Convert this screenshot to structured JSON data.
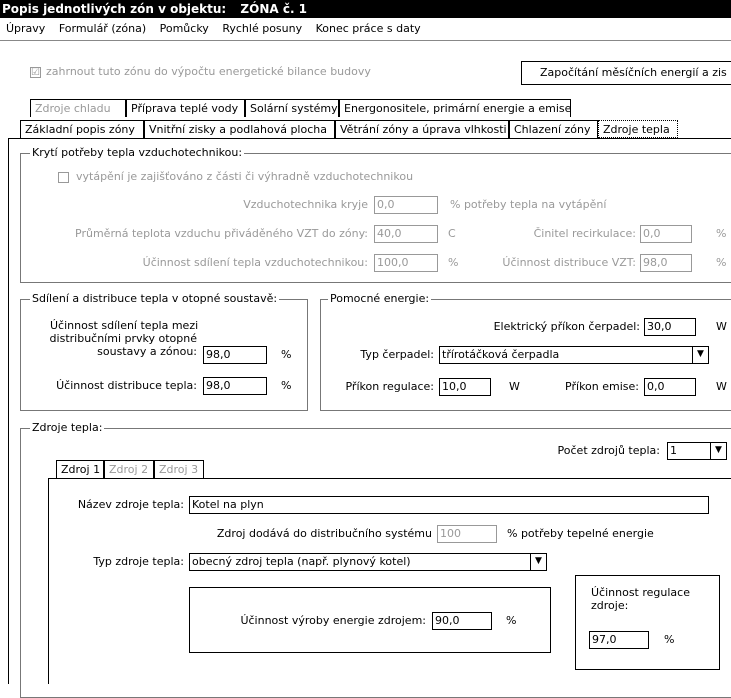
{
  "window": {
    "title": "Popis jednotlivých zón v objektu:",
    "zone": "ZÓNA č. 1"
  },
  "menu": [
    "Úpravy",
    "Formulář (zóna)",
    "Pomůcky",
    "Rychlé posuny",
    "Konec práce s daty"
  ],
  "include_zone": {
    "label": "zahrnout tuto zónu do výpočtu energetické bilance budovy",
    "checked_mark": "☑"
  },
  "monthly_button": "Započítání měsíčních energií a zis",
  "tabs_row1": [
    "Zdroje chladu",
    "Příprava teplé vody",
    "Solární systémy",
    "Energonositele, primární energie a emise"
  ],
  "tabs_row2": [
    "Základní popis zóny",
    "Vnitřní zisky a podlahová plocha",
    "Větrání zóny a úprava vlhkosti",
    "Chlazení zóny",
    "Zdroje tepla"
  ],
  "vzt": {
    "title": "Krytí potřeby tepla vzduchotechnikou:",
    "checkbox_label": "vytápění je zajišťováno z části či výhradně vzduchotechnikou",
    "covers_label": "Vzduchotechnika kryje",
    "covers_value": "0,0",
    "covers_unit": "% potřeby tepla na vytápění",
    "temp_label": "Průměrná teplota vzduchu přiváděného VZT do zóny:",
    "temp_value": "40,0",
    "temp_unit": "C",
    "recirc_label": "Činitel recirkulace:",
    "recirc_value": "0,0",
    "recirc_unit": "%",
    "share_label": "Účinnost sdílení tepla vzduchotechnikou:",
    "share_value": "100,0",
    "share_unit": "%",
    "distrib_label": "Účinnost distribuce VZT:",
    "distrib_value": "98,0",
    "distrib_unit": "%"
  },
  "heating_system": {
    "title": "Sdílení a distribuce tepla v otopné soustavě:",
    "share_label_1": "Účinnost sdílení tepla mezi",
    "share_label_2": "distribučními prvky otopné",
    "share_label_3": "soustavy a zónou:",
    "share_value": "98,0",
    "share_unit": "%",
    "distrib_label": "Účinnost distribuce tepla:",
    "distrib_value": "98,0",
    "distrib_unit": "%"
  },
  "aux": {
    "title": "Pomocné energie:",
    "pump_power_label": "Elektrický příkon čerpadel:",
    "pump_power_value": "30,0",
    "pump_power_unit": "W",
    "pump_type_label": "Typ čerpadel:",
    "pump_type_value": "třírotáčková čerpadla",
    "reg_label": "Příkon regulace:",
    "reg_value": "10,0",
    "reg_unit": "W",
    "emis_label": "Příkon emise:",
    "emis_value": "0,0",
    "emis_unit": "W"
  },
  "sources": {
    "title": "Zdroje tepla:",
    "count_label": "Počet zdrojů tepla:",
    "count_value": "1",
    "tabs": [
      "Zdroj 1",
      "Zdroj 2",
      "Zdroj 3"
    ],
    "name_label": "Název zdroje tepla:",
    "name_value": "Kotel na plyn",
    "supply_label": "Zdroj dodává do distribučního systému",
    "supply_value": "100",
    "supply_unit": "% potřeby tepelné energie",
    "type_label": "Typ zdroje tepla:",
    "type_value": "obecný zdroj tepla (např. plynový kotel)",
    "eff_label": "Účinnost výroby energie zdrojem:",
    "eff_value": "90,0",
    "eff_unit": "%",
    "reg_eff_label_1": "Účinnost regulace",
    "reg_eff_label_2": "zdroje:",
    "reg_eff_value": "97,0",
    "reg_eff_unit": "%"
  }
}
